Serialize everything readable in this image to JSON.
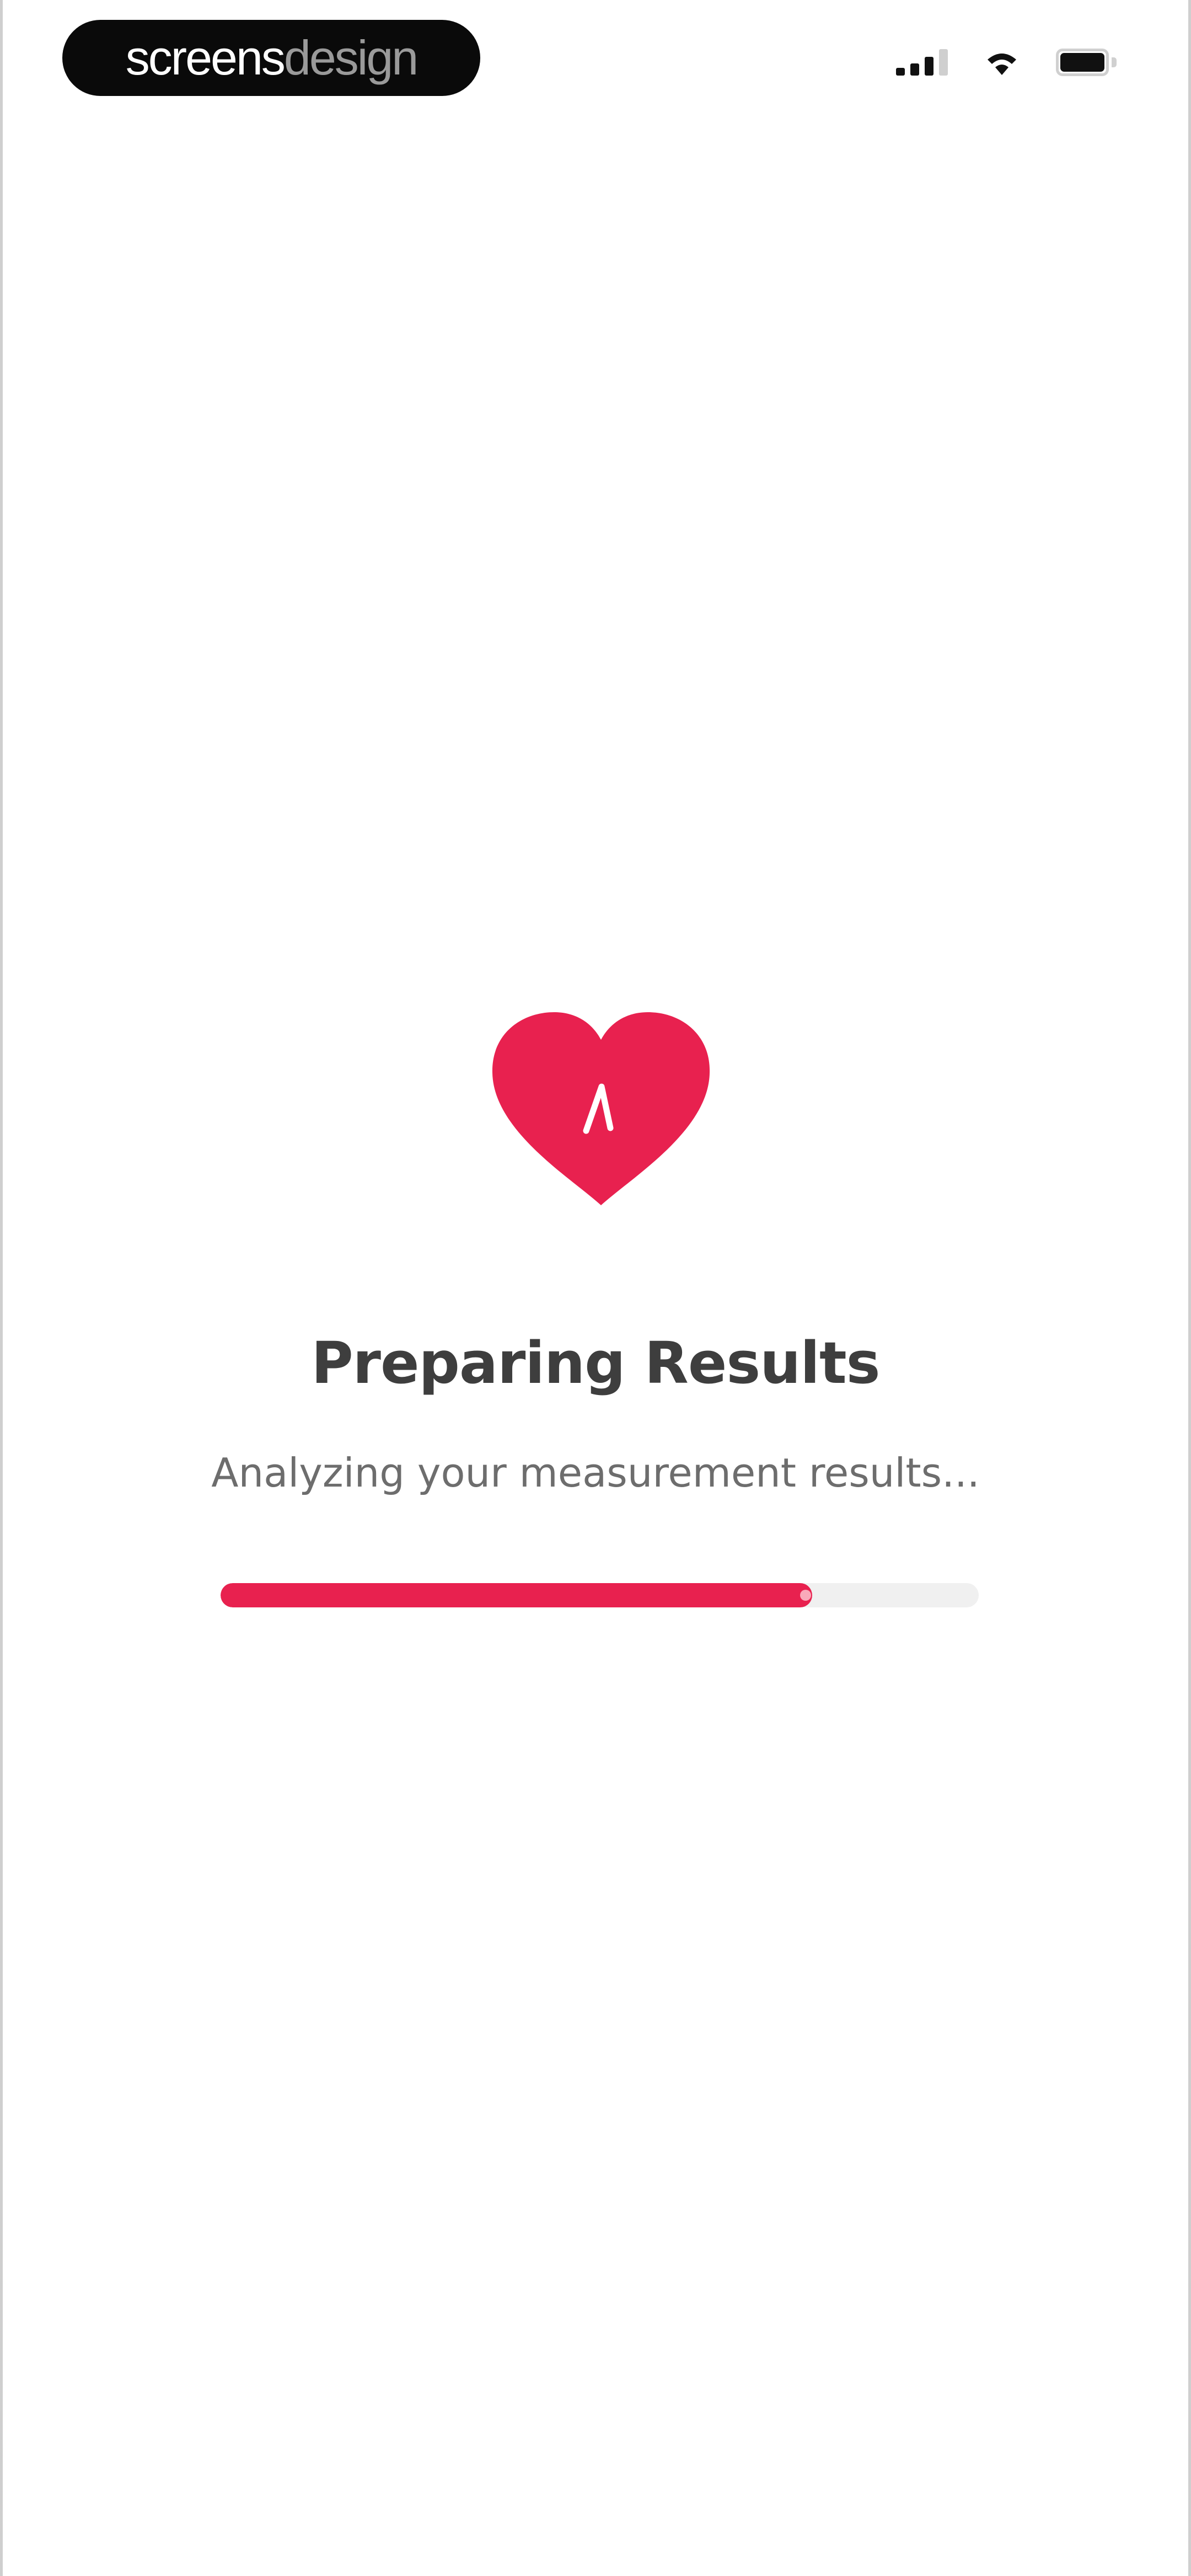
{
  "status_bar": {
    "brand_part1": "screens",
    "brand_part2": "design",
    "signal_icon": "signal-icon",
    "wifi_icon": "wifi-icon",
    "battery_icon": "battery-icon"
  },
  "main": {
    "icon": "heart-pulse-icon",
    "title": "Preparing Results",
    "subtitle": "Analyzing your measurement results...",
    "progress_fraction": 0.78
  },
  "colors": {
    "accent": "#e8214f",
    "title_text": "#3e3e3e",
    "subtitle_text": "#6d6d6d",
    "track": "#f0f0f0"
  }
}
